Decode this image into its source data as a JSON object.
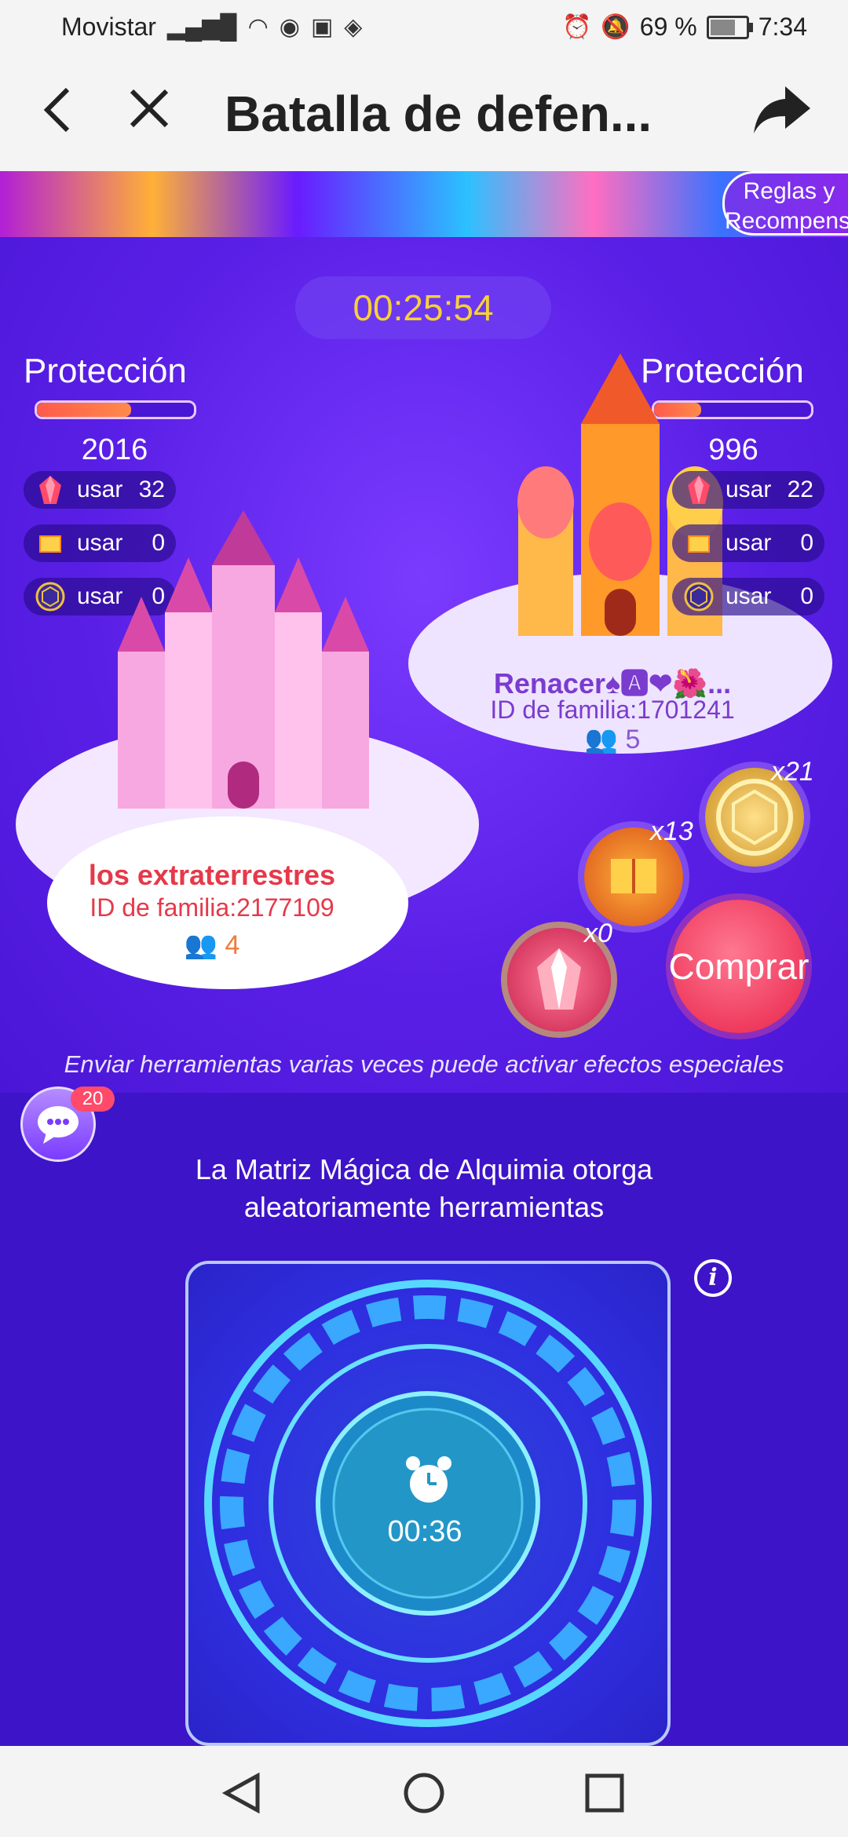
{
  "status_bar": {
    "carrier": "Movistar",
    "battery_pct": "69 %",
    "time": "7:34"
  },
  "app_bar": {
    "title": "Batalla de defen..."
  },
  "banner": {
    "rules_label_line1": "Reglas y",
    "rules_label_line2": "Recompensa"
  },
  "battle": {
    "timer": "00:25:54",
    "left_team": {
      "protection_label": "Protección",
      "protection_value": "2016",
      "protection_fill": 0.6,
      "tools": [
        {
          "icon": "red-crystal-icon",
          "label": "usar",
          "count": "32"
        },
        {
          "icon": "fire-book-icon",
          "label": "usar",
          "count": "0"
        },
        {
          "icon": "gold-shield-icon",
          "label": "usar",
          "count": "0"
        }
      ],
      "name": "los extraterrestres",
      "family_id": "ID de familia:2177109",
      "members": "4"
    },
    "right_team": {
      "protection_label": "Protección",
      "protection_value": "996",
      "protection_fill": 0.3,
      "tools": [
        {
          "icon": "red-crystal-icon",
          "label": "usar",
          "count": "22"
        },
        {
          "icon": "fire-book-icon",
          "label": "usar",
          "count": "0"
        },
        {
          "icon": "gold-shield-icon",
          "label": "usar",
          "count": "0"
        }
      ],
      "name": "Renacer♠🅰❤🌺...",
      "family_id": "ID de familia:1701241",
      "members": "5"
    },
    "inventory": {
      "shield_qty": "x21",
      "book_qty": "x13",
      "crystal_qty": "x0"
    },
    "buy_label": "Comprar",
    "hint": "Enviar herramientas varias veces puede activar efectos especiales"
  },
  "chat": {
    "badge": "20"
  },
  "alchemy": {
    "title_line1": "La Matriz Mágica de Alquimia otorga",
    "title_line2": "aleatoriamente herramientas",
    "countdown": "00:36"
  },
  "colors": {
    "accent_timer": "#f6d03a",
    "left_team": "#e5394a",
    "right_team": "#7b3bcf",
    "buy_button": "#e8224a"
  }
}
